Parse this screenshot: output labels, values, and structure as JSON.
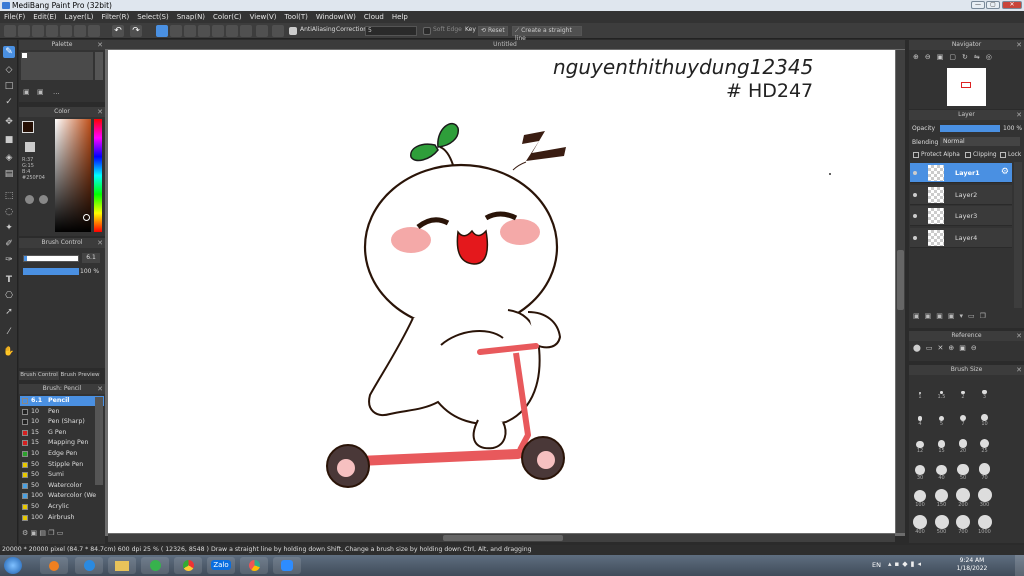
{
  "app": {
    "title": "MediBang Paint Pro (32bit)"
  },
  "menu": [
    "File(F)",
    "Edit(E)",
    "Layer(L)",
    "Filter(R)",
    "Select(S)",
    "Snap(N)",
    "Color(C)",
    "View(V)",
    "Tool(T)",
    "Window(W)",
    "Cloud",
    "Help"
  ],
  "toolbar": {
    "antialias_label": "AntiAliasing",
    "correction_label": "Correction",
    "correction_value": "5",
    "soft_edge_label": "Soft Edge",
    "key_label": "Key",
    "reset_label": "Reset",
    "straight_line_label": "Create a straight line"
  },
  "document": {
    "tab_title": "Untitled"
  },
  "palette": {
    "title": "Palette",
    "more": "..."
  },
  "color": {
    "title": "Color",
    "r": "R:37",
    "g": "G:15",
    "b": "B:4",
    "hex": "#250F04",
    "fg": "#250F04",
    "bg": "#ffffff"
  },
  "brush_control": {
    "title": "Brush Control",
    "size": "6.1",
    "opacity": "100 %"
  },
  "panel_tabs": [
    "Brush Control",
    "Brush Preview"
  ],
  "brush_list": {
    "title": "Brush: Pencil",
    "items": [
      {
        "size": "6.1",
        "name": "Pencil",
        "color": "#4a90e2"
      },
      {
        "size": "10",
        "name": "Pen",
        "color": "#222222"
      },
      {
        "size": "10",
        "name": "Pen (Sharp)",
        "color": "#222222"
      },
      {
        "size": "15",
        "name": "G Pen",
        "color": "#d42020"
      },
      {
        "size": "15",
        "name": "Mapping Pen",
        "color": "#d42020"
      },
      {
        "size": "10",
        "name": "Edge Pen",
        "color": "#2ca02c"
      },
      {
        "size": "50",
        "name": "Stipple Pen",
        "color": "#e6c800"
      },
      {
        "size": "50",
        "name": "Sumi",
        "color": "#e6c800"
      },
      {
        "size": "50",
        "name": "Watercolor",
        "color": "#4aa0e0"
      },
      {
        "size": "100",
        "name": "Watercolor (We",
        "color": "#4aa0e0"
      },
      {
        "size": "50",
        "name": "Acrylic",
        "color": "#e6c800"
      },
      {
        "size": "100",
        "name": "Airbrush",
        "color": "#e6c800"
      }
    ]
  },
  "navigator": {
    "title": "Navigator"
  },
  "layer_panel": {
    "title": "Layer",
    "opacity_label": "Opacity",
    "opacity_value": "100 %",
    "blending_label": "Blending",
    "blending_value": "Normal",
    "protect_alpha": "Protect Alpha",
    "clipping": "Clipping",
    "lock": "Lock",
    "layers": [
      "Layer1",
      "Layer2",
      "Layer3",
      "Layer4"
    ],
    "selected": 0
  },
  "reference": {
    "title": "Reference"
  },
  "brush_size": {
    "title": "Brush Size",
    "sizes": [
      "1",
      "1.5",
      "2",
      "3",
      "4",
      "5",
      "7",
      "10",
      "12",
      "15",
      "20",
      "25",
      "30",
      "40",
      "50",
      "70",
      "100",
      "150",
      "200",
      "300",
      "400",
      "500",
      "700",
      "1000"
    ]
  },
  "artwork": {
    "signature": "nguyenthithuydung12345",
    "hashtag": "# HD247"
  },
  "status": {
    "dimensions": "20000 * 20000 pixel",
    "physical": "(84.7 * 84.7cm)",
    "dpi": "600 dpi",
    "zoom": "25 %",
    "coords": "( 12326, 8548 )",
    "hint": "Draw a straight line by holding down Shift, Change a brush size by holding down Ctrl, Alt, and dragging"
  },
  "taskbar": {
    "lang": "EN",
    "time": "9:24 AM",
    "date": "1/18/2022",
    "zalo": "Zalo"
  }
}
